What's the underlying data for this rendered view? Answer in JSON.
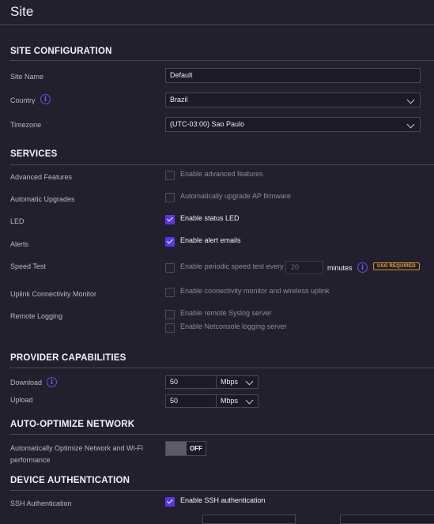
{
  "page": {
    "title": "Site"
  },
  "sections": {
    "site_configuration": "SITE CONFIGURATION",
    "services": "SERVICES",
    "provider_capabilities": "PROVIDER CAPABILITIES",
    "auto_optimize": "AUTO-OPTIMIZE NETWORK",
    "device_authentication": "DEVICE AUTHENTICATION"
  },
  "site_config": {
    "site_name_label": "Site Name",
    "site_name_value": "Default",
    "country_label": "Country",
    "country_value": "Brazil",
    "timezone_label": "Timezone",
    "timezone_value": "(UTC-03:00) Sao Paulo"
  },
  "services": {
    "advanced_features": {
      "label": "Advanced Features",
      "option": "Enable advanced features",
      "checked": false
    },
    "automatic_upgrades": {
      "label": "Automatic Upgrades",
      "option": "Automatically upgrade AP firmware",
      "checked": false
    },
    "led": {
      "label": "LED",
      "option": "Enable status LED",
      "checked": true
    },
    "alerts": {
      "label": "Alerts",
      "option": "Enable alert emails",
      "checked": true
    },
    "speed_test": {
      "label": "Speed Test",
      "option": "Enable periodic speed test every",
      "interval_placeholder": "20",
      "unit": "minutes",
      "badge": "USG REQUIRED",
      "checked": false
    },
    "uplink_monitor": {
      "label": "Uplink Connectivity Monitor",
      "option": "Enable connectivity monitor and wireless uplink",
      "checked": false
    },
    "remote_logging": {
      "label": "Remote Logging",
      "syslog_option": "Enable remote Syslog server",
      "netconsole_option": "Enable Netconsole logging server",
      "syslog_checked": false,
      "netconsole_checked": false
    }
  },
  "provider": {
    "download_label": "Download",
    "download_value": "50",
    "download_unit": "Mbps",
    "upload_label": "Upload",
    "upload_value": "50",
    "upload_unit": "Mbps"
  },
  "auto_optimize": {
    "label": "Automatically Optimize Network and Wi-Fi performance",
    "toggle_state": "OFF"
  },
  "device_auth": {
    "ssh_label": "SSH Authentication",
    "ssh_option": "Enable SSH authentication",
    "ssh_checked": true
  },
  "colors": {
    "background": "#23202e",
    "accent": "#5b35e8",
    "badge": "#e6a23c"
  }
}
